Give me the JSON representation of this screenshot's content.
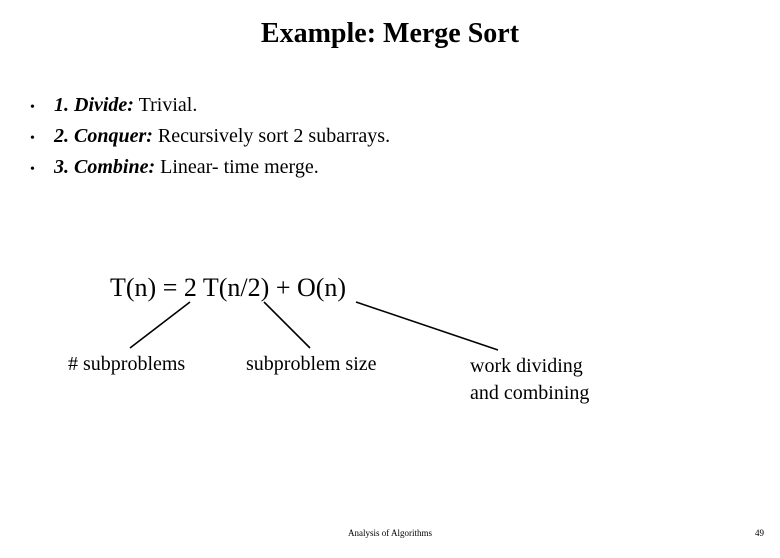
{
  "title": "Example: Merge Sort",
  "bullets": [
    {
      "num": "1. Divide:",
      "rest": " Trivial."
    },
    {
      "num": "2. Conquer:",
      "rest": " Recursively sort 2 subarrays."
    },
    {
      "num": "3. Combine:",
      "rest": " Linear- time merge."
    }
  ],
  "formula": "T(n) = 2 T(n/2) + O(n)",
  "labels": {
    "l1": "# subproblems",
    "l2": "subproblem size",
    "l3a": "work dividing",
    "l3b": "and combining"
  },
  "footer": "Analysis of Algorithms",
  "pagenum": "49"
}
